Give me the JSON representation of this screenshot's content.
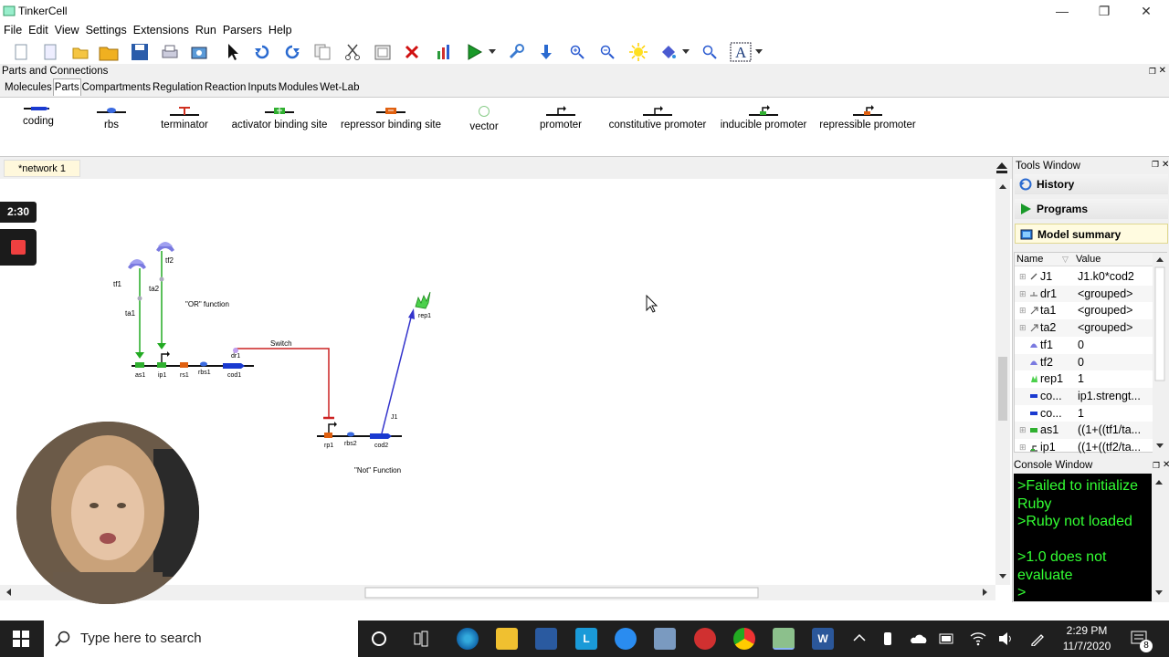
{
  "window": {
    "title": "TinkerCell"
  },
  "menu": [
    "File",
    "Edit",
    "View",
    "Settings",
    "Extensions",
    "Run",
    "Parsers",
    "Help"
  ],
  "parts_panel": {
    "title": "Parts and Connections",
    "tabs": [
      "Molecules",
      "Parts",
      "Compartments",
      "Regulation",
      "Reaction",
      "Inputs",
      "Modules",
      "Wet-Lab"
    ],
    "active_tab": "Parts",
    "items": [
      "coding",
      "rbs",
      "terminator",
      "activator binding site",
      "repressor binding site",
      "vector",
      "promoter",
      "constitutive promoter",
      "inducible promoter",
      "repressible promoter"
    ]
  },
  "network": {
    "tab": "*network 1",
    "labels": {
      "tf1": "tf1",
      "tf2": "tf2",
      "ta1": "ta1",
      "ta2": "ta2",
      "or_function": "\"OR\" function",
      "switch": "Switch",
      "dr1": "dr1",
      "as1": "as1",
      "ip1": "ip1",
      "rs1": "rs1",
      "rbs1": "rbs1",
      "cod1": "cod1",
      "rep1": "rep1",
      "j1": "J1",
      "rp1": "rp1",
      "rbs2": "rbs2",
      "cod2": "cod2",
      "not_function": "\"Not\" Function"
    }
  },
  "tools_window": {
    "title": "Tools Window",
    "sections": [
      "History",
      "Programs",
      "Model summary"
    ],
    "columns": [
      "Name",
      "Value"
    ],
    "rows": [
      {
        "name": "J1",
        "value": "J1.k0*cod2"
      },
      {
        "name": "dr1",
        "value": "<grouped>"
      },
      {
        "name": "ta1",
        "value": "<grouped>"
      },
      {
        "name": "ta2",
        "value": "<grouped>"
      },
      {
        "name": "tf1",
        "value": "0"
      },
      {
        "name": "tf2",
        "value": "0"
      },
      {
        "name": "rep1",
        "value": "1"
      },
      {
        "name": "co...",
        "value": "ip1.strengt..."
      },
      {
        "name": "co...",
        "value": "1"
      },
      {
        "name": "as1",
        "value": "((1+((tf1/ta..."
      },
      {
        "name": "ip1",
        "value": "((1+((tf2/ta..."
      }
    ]
  },
  "console": {
    "title": "Console Window",
    "lines": [
      ">Failed to initialize Ruby",
      ">Ruby not loaded",
      "",
      ">1.0 does not evaluate",
      ">"
    ]
  },
  "recording": {
    "timer": "2:30"
  },
  "taskbar": {
    "search_placeholder": "Type here to search",
    "time": "2:29 PM",
    "date": "11/7/2020",
    "notification_count": "8"
  },
  "colors": {
    "console_text": "#33ff33",
    "activation_line": "#22aa22",
    "repression_line": "#cc2222",
    "production_line": "#3333cc"
  }
}
